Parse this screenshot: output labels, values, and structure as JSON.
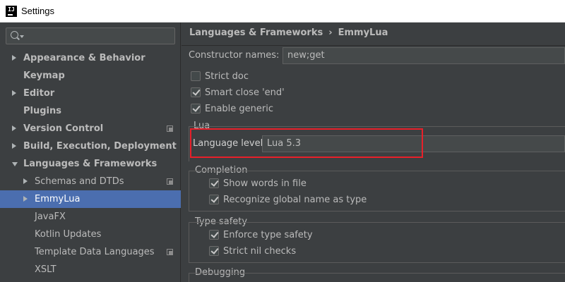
{
  "window": {
    "title": "Settings",
    "app_icon_text": "IJ"
  },
  "sidebar": {
    "search_placeholder": "",
    "items": [
      {
        "label": "Appearance & Behavior",
        "bold": true,
        "arrow": "right",
        "indent": 0,
        "copy": false,
        "selected": false
      },
      {
        "label": "Keymap",
        "bold": true,
        "arrow": "",
        "indent": 0,
        "copy": false,
        "selected": false
      },
      {
        "label": "Editor",
        "bold": true,
        "arrow": "right",
        "indent": 0,
        "copy": false,
        "selected": false
      },
      {
        "label": "Plugins",
        "bold": true,
        "arrow": "",
        "indent": 0,
        "copy": false,
        "selected": false
      },
      {
        "label": "Version Control",
        "bold": true,
        "arrow": "right",
        "indent": 0,
        "copy": true,
        "selected": false
      },
      {
        "label": "Build, Execution, Deployment",
        "bold": true,
        "arrow": "right",
        "indent": 0,
        "copy": false,
        "selected": false
      },
      {
        "label": "Languages & Frameworks",
        "bold": true,
        "arrow": "down",
        "indent": 0,
        "copy": false,
        "selected": false
      },
      {
        "label": "Schemas and DTDs",
        "bold": false,
        "arrow": "right",
        "indent": 1,
        "copy": true,
        "selected": false
      },
      {
        "label": "EmmyLua",
        "bold": false,
        "arrow": "right",
        "indent": 1,
        "copy": false,
        "selected": true
      },
      {
        "label": "JavaFX",
        "bold": false,
        "arrow": "",
        "indent": 1,
        "copy": false,
        "selected": false
      },
      {
        "label": "Kotlin Updates",
        "bold": false,
        "arrow": "",
        "indent": 1,
        "copy": false,
        "selected": false
      },
      {
        "label": "Template Data Languages",
        "bold": false,
        "arrow": "",
        "indent": 1,
        "copy": true,
        "selected": false
      },
      {
        "label": "XSLT",
        "bold": false,
        "arrow": "",
        "indent": 1,
        "copy": false,
        "selected": false
      }
    ]
  },
  "main": {
    "breadcrumb": {
      "parent": "Languages & Frameworks",
      "separator": "›",
      "current": "EmmyLua"
    },
    "constructor_names": {
      "label": "Constructor names:",
      "value": "new;get"
    },
    "options": {
      "strict_doc": {
        "label": "Strict doc",
        "checked": false
      },
      "smart_close": {
        "label": "Smart close 'end'",
        "checked": true
      },
      "enable_generic": {
        "label": "Enable generic",
        "checked": true
      }
    },
    "lua_group": {
      "title": "Lua",
      "language_level_label": "Language level",
      "language_level_value": "Lua 5.3"
    },
    "completion_group": {
      "title": "Completion",
      "show_words": {
        "label": "Show words in file",
        "checked": true
      },
      "recognize_global": {
        "label": "Recognize global name as type",
        "checked": true
      }
    },
    "type_safety_group": {
      "title": "Type safety",
      "enforce": {
        "label": "Enforce type safety",
        "checked": true
      },
      "strict_nil": {
        "label": "Strict nil checks",
        "checked": true
      }
    },
    "debugging_group": {
      "title": "Debugging"
    }
  },
  "colors": {
    "background": "#3c3f41",
    "selection": "#4b6eaf",
    "highlight_box": "#e8202a",
    "text": "#bbbbbb"
  }
}
